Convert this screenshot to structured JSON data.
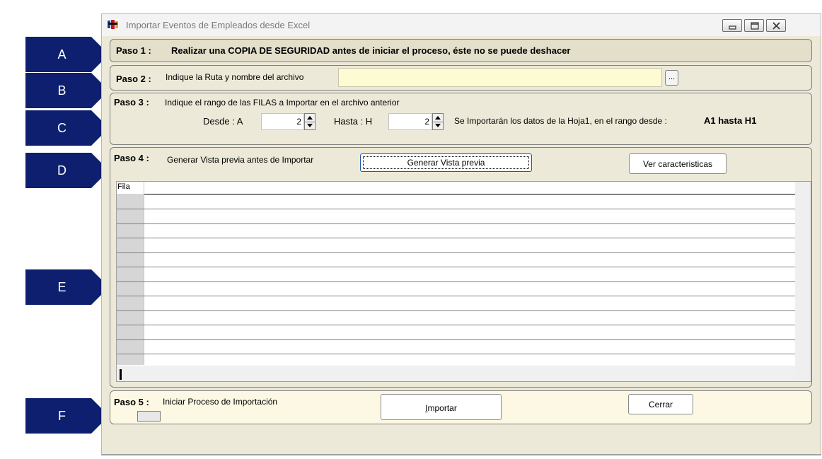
{
  "window": {
    "title": "Importar Eventos de Empleados desde Excel",
    "controls": [
      "minimize",
      "maximize",
      "close"
    ]
  },
  "step1": {
    "label": "Paso 1 :",
    "text": "Realizar una COPIA DE SEGURIDAD antes de iniciar el proceso, éste no se puede deshacer"
  },
  "step2": {
    "label": "Paso 2 :",
    "text": "Indique la Ruta y nombre del archivo",
    "path_value": "",
    "browse_label": "..."
  },
  "step3": {
    "label": "Paso 3 :",
    "text": "Indique el rango de las FILAS a Importar en el archivo anterior",
    "from_label": "Desde  :  A",
    "from_value": "2",
    "to_label": "Hasta  :  H",
    "to_value": "2",
    "info_text": "Se Importarán los datos de la Hoja1,  en el rango desde :",
    "range_text": "A1 hasta H1"
  },
  "step4": {
    "label": "Paso 4 :",
    "text": "Generar Vista previa antes de Importar",
    "preview_button": "Generar Vista previa",
    "features_button": "Ver caracteristicas",
    "grid_header": "Fila"
  },
  "step5": {
    "label": "Paso 5 :",
    "text": "Iniciar Proceso de Importación",
    "import_button_first": "I",
    "import_button_rest": "mportar",
    "close_button": "Cerrar"
  },
  "callouts": [
    "A",
    "B",
    "C",
    "D",
    "E",
    "F"
  ],
  "colors": {
    "callout": "#0e1f6f",
    "highlight_field": "#fdfbd3",
    "step5_bg": "#fcf8e3"
  }
}
